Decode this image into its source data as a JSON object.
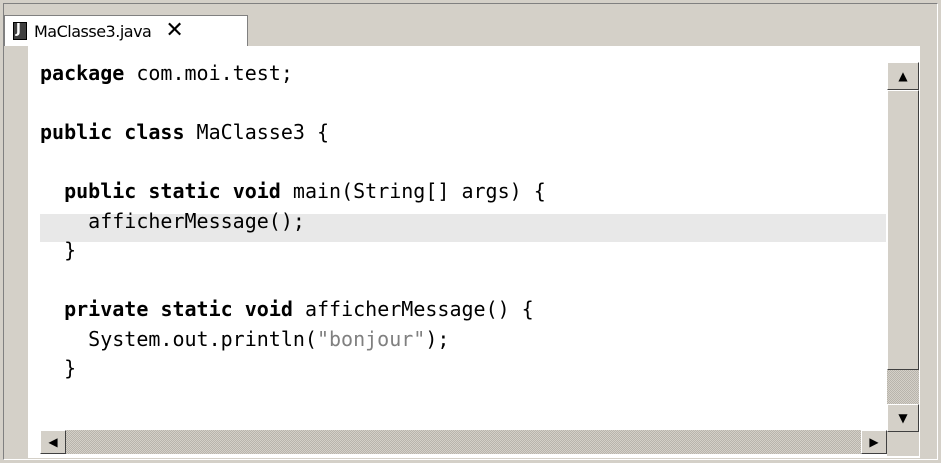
{
  "tab": {
    "title": "MaClasse3.java",
    "close_glyph": "✕",
    "icon": "java-file-icon"
  },
  "editor": {
    "lines": [
      [
        {
          "t": "package",
          "k": "kw"
        },
        {
          "t": " com.moi.test;"
        }
      ],
      [],
      [
        {
          "t": "public",
          "k": "kw"
        },
        {
          "t": " "
        },
        {
          "t": "class",
          "k": "kw"
        },
        {
          "t": " MaClasse3 {"
        }
      ],
      [],
      [
        {
          "t": "  "
        },
        {
          "t": "public",
          "k": "kw"
        },
        {
          "t": " "
        },
        {
          "t": "static",
          "k": "kw"
        },
        {
          "t": " "
        },
        {
          "t": "void",
          "k": "kw"
        },
        {
          "t": " main(String[] args) {"
        }
      ],
      [
        {
          "t": "    afficherMessage();"
        }
      ],
      [
        {
          "t": "  }"
        }
      ],
      [],
      [
        {
          "t": "  "
        },
        {
          "t": "private",
          "k": "kw"
        },
        {
          "t": " "
        },
        {
          "t": "static",
          "k": "kw"
        },
        {
          "t": " "
        },
        {
          "t": "void",
          "k": "kw"
        },
        {
          "t": " afficherMessage() {"
        }
      ],
      [
        {
          "t": "    System.out.println("
        },
        {
          "t": "\"bonjour\"",
          "k": "str"
        },
        {
          "t": ");"
        }
      ],
      [
        {
          "t": "  }"
        }
      ]
    ],
    "current_line": 6
  },
  "scrollbars": {
    "up_glyph": "▲",
    "down_glyph": "▼",
    "left_glyph": "◀",
    "right_glyph": "▶"
  },
  "colors": {
    "chrome": "#d4d0c8",
    "editor_bg": "#ffffff",
    "current_line_bg": "#e8e8e8",
    "string": "#808080"
  }
}
